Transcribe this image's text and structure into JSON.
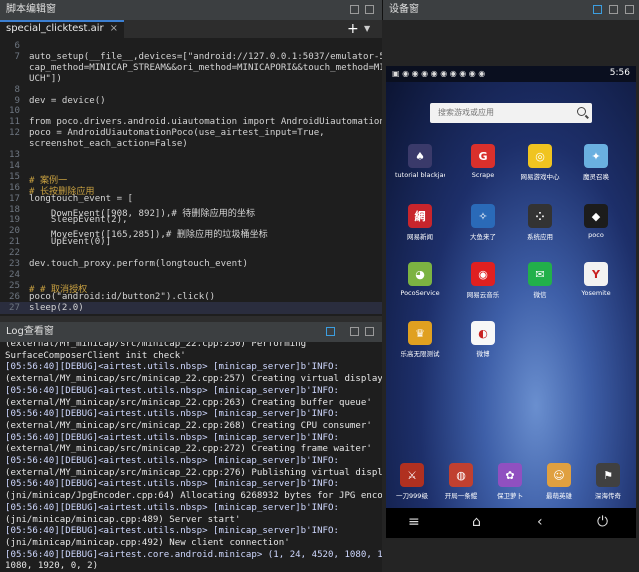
{
  "editor": {
    "title": "脚本编辑窗",
    "tab": "special_clicktest.air",
    "tab_close": "×",
    "add": "+",
    "lines": [
      {
        "n": "6",
        "t": ""
      },
      {
        "n": "7",
        "t": "auto_setup(__file__,devices=[\"android://127.0.0.1:5037/emulator-5554?"
      },
      {
        "n": "",
        "t": "cap_method=MINICAP_STREAM&&ori_method=MINICAPORI&&touch_method=MINITO"
      },
      {
        "n": "",
        "t": "UCH\"])"
      },
      {
        "n": "8",
        "t": ""
      },
      {
        "n": "9",
        "t": "dev = device()"
      },
      {
        "n": "10",
        "t": ""
      },
      {
        "n": "11",
        "t": "from poco.drivers.android.uiautomation import AndroidUiautomationPoco"
      },
      {
        "n": "12",
        "t": "poco = AndroidUiautomationPoco(use_airtest_input=True,"
      },
      {
        "n": "",
        "t": "screenshot_each_action=False)"
      },
      {
        "n": "13",
        "t": ""
      },
      {
        "n": "14",
        "t": ""
      },
      {
        "n": "15",
        "t": "# 案例一"
      },
      {
        "n": "16",
        "t": "# 长按删除应用"
      },
      {
        "n": "17",
        "t": "longtouch_event = ["
      },
      {
        "n": "18",
        "t": "    DownEvent([908, 892]),# 待删除应用的坐标"
      },
      {
        "n": "19",
        "t": "    SleepEvent(2),"
      },
      {
        "n": "20",
        "t": "    MoveEvent([165,285]),# 删除应用的垃圾桶坐标"
      },
      {
        "n": "21",
        "t": "    UpEvent(0)]"
      },
      {
        "n": "22",
        "t": ""
      },
      {
        "n": "23",
        "t": "dev.touch_proxy.perform(longtouch_event)"
      },
      {
        "n": "24",
        "t": ""
      },
      {
        "n": "25",
        "t": "# # 取消授权"
      },
      {
        "n": "26",
        "t": "poco(\"android:id/button2\").click()"
      },
      {
        "n": "27",
        "t": "sleep(2.0)"
      }
    ]
  },
  "log": {
    "title": "Log查看窗",
    "lines": [
      "(external/MY_minicap/src/minicap_22.cpp:250) Performing",
      "SurfaceComposerClient init check'",
      "[05:56:40][DEBUG]<airtest.utils.nbsp> [minicap_server]b'INFO:",
      "(external/MY_minicap/src/minicap_22.cpp:257) Creating virtual display'",
      "[05:56:40][DEBUG]<airtest.utils.nbsp> [minicap_server]b'INFO:",
      "(external/MY_minicap/src/minicap_22.cpp:263) Creating buffer queue'",
      "[05:56:40][DEBUG]<airtest.utils.nbsp> [minicap_server]b'INFO:",
      "(external/MY_minicap/src/minicap_22.cpp:268) Creating CPU consumer'",
      "[05:56:40][DEBUG]<airtest.utils.nbsp> [minicap_server]b'INFO:",
      "(external/MY_minicap/src/minicap_22.cpp:272) Creating frame waiter'",
      "[05:56:40][DEBUG]<airtest.utils.nbsp> [minicap_server]b'INFO:",
      "(external/MY_minicap/src/minicap_22.cpp:276) Publishing virtual display'",
      "[05:56:40][DEBUG]<airtest.utils.nbsp> [minicap_server]b'INFO:",
      "(jni/minicap/JpgEncoder.cpp:64) Allocating 6268932 bytes for JPG encoder'",
      "[05:56:40][DEBUG]<airtest.utils.nbsp> [minicap_server]b'INFO:",
      "(jni/minicap/minicap.cpp:489) Server start'",
      "[05:56:40][DEBUG]<airtest.utils.nbsp> [minicap_server]b'INFO:",
      "(jni/minicap/minicap.cpp:492) New client connection'",
      "[05:56:40][DEBUG]<airtest.core.android.minicap> (1, 24, 4520, 1080, 1920,",
      "1080, 1920, 0, 2)"
    ]
  },
  "device": {
    "title": "设备窗",
    "clock": "5:56",
    "search_placeholder": "搜索游戏或应用",
    "apps": [
      {
        "label": "tutorial blackjack",
        "glyph": "♠",
        "color": "#3a3a6a"
      },
      {
        "label": "Scrape",
        "glyph": "G",
        "color": "#d9302c"
      },
      {
        "label": "网易游戏中心",
        "glyph": "◎",
        "color": "#f0c420"
      },
      {
        "label": "魔灵召唤",
        "glyph": "✦",
        "color": "#6ab0e0"
      },
      {
        "label": "网易新闻",
        "glyph": "網",
        "color": "#c8252c"
      },
      {
        "label": "大鱼来了",
        "glyph": "✧",
        "color": "#2a6ab8"
      },
      {
        "label": "系统应用",
        "glyph": "⁘",
        "color": "#333333"
      },
      {
        "label": "poco",
        "glyph": "◆",
        "color": "#1c1c1c"
      },
      {
        "label": "PocoService",
        "glyph": "◕",
        "color": "#7cb342"
      },
      {
        "label": "网易云音乐",
        "glyph": "◉",
        "color": "#e02020"
      },
      {
        "label": "微信",
        "glyph": "✉",
        "color": "#22b04a"
      },
      {
        "label": "Yosemite",
        "glyph": "Y",
        "color": "#f2f2f2"
      },
      {
        "label": "乐高无限测试",
        "glyph": "♛",
        "color": "#e0a020"
      },
      {
        "label": "微博",
        "glyph": "◐",
        "color": "#f7f7f7"
      }
    ],
    "dock": [
      {
        "label": "一刀999级",
        "glyph": "⚔",
        "color": "#b03020"
      },
      {
        "label": "开局一条鲲",
        "glyph": "◍",
        "color": "#c04030"
      },
      {
        "label": "保卫萝卜",
        "glyph": "✿",
        "color": "#9050c0"
      },
      {
        "label": "最萌英雄",
        "glyph": "☺",
        "color": "#e0a040"
      },
      {
        "label": "深海传奇",
        "glyph": "⚑",
        "color": "#404040"
      }
    ],
    "nav": {
      "menu": "≡",
      "home": "⌂",
      "back": "‹",
      "power": "⏻"
    }
  }
}
